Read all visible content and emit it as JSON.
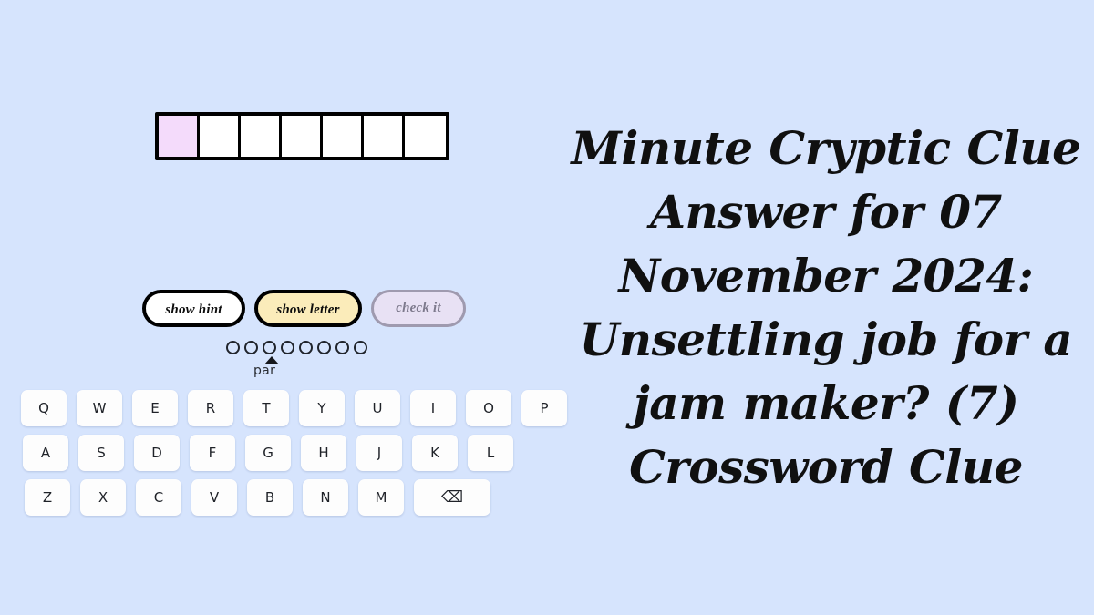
{
  "page": {
    "background_color": "#d6e4fd"
  },
  "headline": {
    "text": "Minute Cryptic Clue Answer for 07 November 2024: Unsettling job for a jam maker? (7) Crossword Clue"
  },
  "game": {
    "grid": {
      "cell_count": 7,
      "active_index": 0,
      "active_cell_color": "#f4dbfb",
      "cells": [
        "",
        "",
        "",
        "",
        "",
        "",
        ""
      ]
    },
    "buttons": [
      {
        "id": "show-hint",
        "label": "show hint",
        "fill": "#ffffff",
        "border": "#000000",
        "text_color": "#0c0c0c",
        "disabled": false
      },
      {
        "id": "show-letter",
        "label": "show letter",
        "fill": "#fbecba",
        "border": "#000000",
        "text_color": "#0c0c0c",
        "disabled": false
      },
      {
        "id": "check-it",
        "label": "check it",
        "fill": "#e8e1f4",
        "border": "#9f9aaf",
        "text_color": "#7e7a8d",
        "disabled": true
      }
    ],
    "par_tracker": {
      "dot_count": 8,
      "filled_count": 0,
      "marker_index": 2,
      "label": "par"
    },
    "keyboard": {
      "row1": [
        "Q",
        "W",
        "E",
        "R",
        "T",
        "Y",
        "U",
        "I",
        "O",
        "P"
      ],
      "row2": [
        "A",
        "S",
        "D",
        "F",
        "G",
        "H",
        "J",
        "K",
        "L"
      ],
      "row3": [
        "Z",
        "X",
        "C",
        "V",
        "B",
        "N",
        "M"
      ],
      "backspace_glyph": "⌫"
    }
  }
}
